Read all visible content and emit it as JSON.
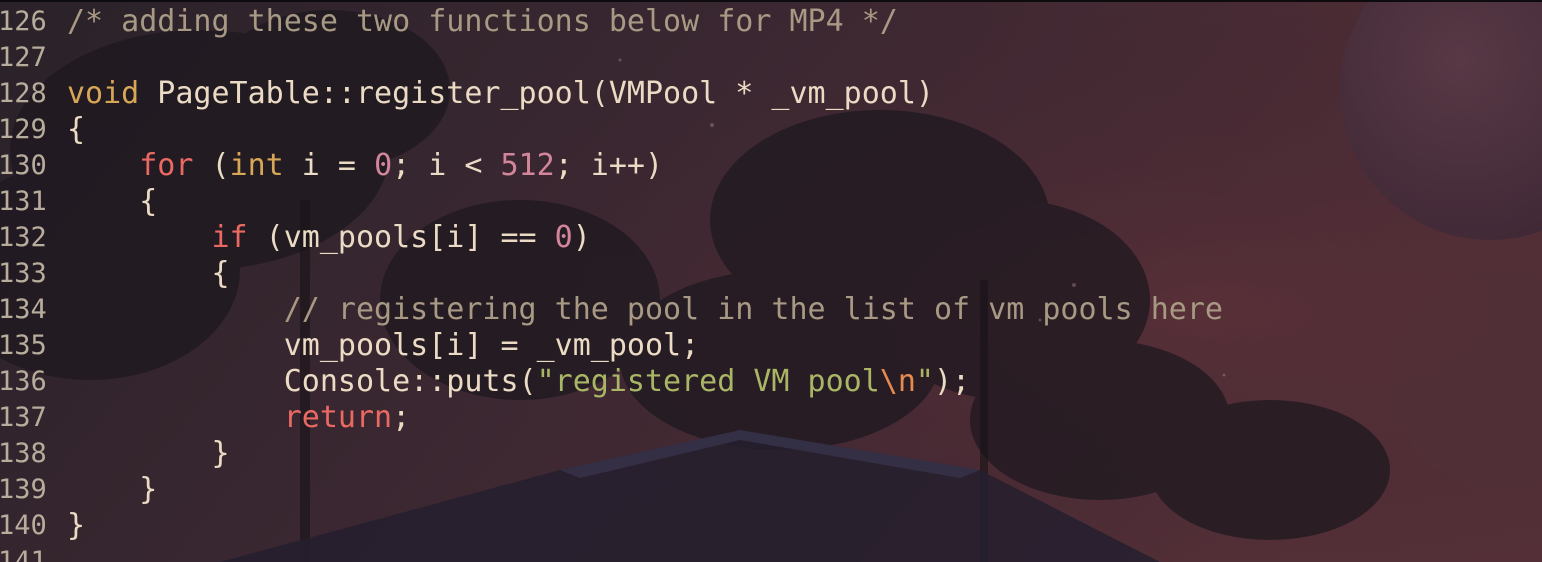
{
  "editor": {
    "lines": [
      {
        "num": "126",
        "tokens": [
          {
            "t": "/* adding these two functions below for MP4 */",
            "c": "com"
          }
        ]
      },
      {
        "num": "127",
        "tokens": []
      },
      {
        "num": "128",
        "tokens": [
          {
            "t": "void",
            "c": "kw-ylw"
          },
          {
            "t": " PageTable::register_pool(VMPool * _vm_pool)",
            "c": "plain"
          }
        ]
      },
      {
        "num": "129",
        "tokens": [
          {
            "t": "{",
            "c": "plain"
          }
        ]
      },
      {
        "num": "130",
        "tokens": [
          {
            "t": "    ",
            "c": "plain"
          },
          {
            "t": "for",
            "c": "kw-red"
          },
          {
            "t": " (",
            "c": "plain"
          },
          {
            "t": "int",
            "c": "kw-ylw"
          },
          {
            "t": " i = ",
            "c": "plain"
          },
          {
            "t": "0",
            "c": "num"
          },
          {
            "t": "; i < ",
            "c": "plain"
          },
          {
            "t": "512",
            "c": "num"
          },
          {
            "t": "; i++)",
            "c": "plain"
          }
        ]
      },
      {
        "num": "131",
        "tokens": [
          {
            "t": "    {",
            "c": "plain"
          }
        ]
      },
      {
        "num": "132",
        "tokens": [
          {
            "t": "        ",
            "c": "plain"
          },
          {
            "t": "if",
            "c": "kw-red"
          },
          {
            "t": " (vm_pools[i] == ",
            "c": "plain"
          },
          {
            "t": "0",
            "c": "num"
          },
          {
            "t": ")",
            "c": "plain"
          }
        ]
      },
      {
        "num": "133",
        "tokens": [
          {
            "t": "        {",
            "c": "plain"
          }
        ]
      },
      {
        "num": "134",
        "tokens": [
          {
            "t": "            ",
            "c": "plain"
          },
          {
            "t": "// registering the pool in the list of vm pools here",
            "c": "com"
          }
        ]
      },
      {
        "num": "135",
        "tokens": [
          {
            "t": "            vm_pools[i] = _vm_pool;",
            "c": "plain"
          }
        ]
      },
      {
        "num": "136",
        "tokens": [
          {
            "t": "            Console::puts(",
            "c": "plain"
          },
          {
            "t": "\"registered VM pool",
            "c": "str"
          },
          {
            "t": "\\n",
            "c": "esc"
          },
          {
            "t": "\"",
            "c": "str"
          },
          {
            "t": ");",
            "c": "plain"
          }
        ]
      },
      {
        "num": "137",
        "tokens": [
          {
            "t": "            ",
            "c": "plain"
          },
          {
            "t": "return",
            "c": "kw-red"
          },
          {
            "t": ";",
            "c": "plain"
          }
        ]
      },
      {
        "num": "138",
        "tokens": [
          {
            "t": "        }",
            "c": "plain"
          }
        ]
      },
      {
        "num": "139",
        "tokens": [
          {
            "t": "    }",
            "c": "plain"
          }
        ]
      },
      {
        "num": "140",
        "tokens": [
          {
            "t": "}",
            "c": "plain"
          }
        ]
      },
      {
        "num": "141",
        "tokens": []
      }
    ]
  },
  "colors": {
    "keyword_control": "#ea6962",
    "keyword_type": "#d8a657",
    "number": "#d3869b",
    "string": "#a9b665",
    "escape": "#e78a4e",
    "comment": "#a89984",
    "text": "#ebdbc4",
    "line_number": "#b8ad9c"
  }
}
